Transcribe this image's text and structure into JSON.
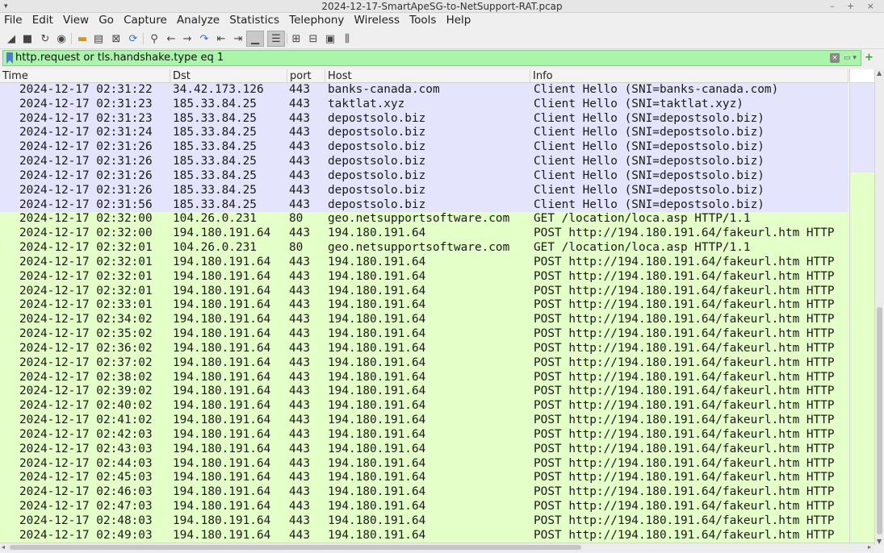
{
  "window": {
    "title": "2024-12-17-SmartApeSG-to-NetSupport-RAT.pcap",
    "controls": "– + ×"
  },
  "menu": [
    "File",
    "Edit",
    "View",
    "Go",
    "Capture",
    "Analyze",
    "Statistics",
    "Telephony",
    "Wireless",
    "Tools",
    "Help"
  ],
  "toolbar_icons": [
    "start-capture-icon",
    "stop-capture-icon",
    "restart-capture-icon",
    "capture-options-icon",
    "open-file-icon",
    "save-file-icon",
    "close-file-icon",
    "reload-file-icon",
    "find-packet-icon",
    "go-back-icon",
    "go-forward-icon",
    "go-to-packet-icon",
    "first-packet-icon",
    "last-packet-icon",
    "auto-scroll-icon",
    "colorize-icon",
    "zoom-in-icon",
    "zoom-out-icon",
    "normal-size-icon",
    "resize-columns-icon"
  ],
  "filter": {
    "value": "http.request or tls.handshake.type eq 1",
    "clear_glyph": "×",
    "recent_glyph": "▭ ▾",
    "apply_glyph": "+"
  },
  "columns": {
    "time": "Time",
    "dst": "Dst",
    "port": "port",
    "host": "Host",
    "info": "Info"
  },
  "colors": {
    "tls_row": "#e4e4fd",
    "http_row": "#e4ffc7",
    "filter_bg": "#aaf5aa"
  },
  "rows": [
    {
      "type": "tls",
      "time": "2024-12-17 02:31:22",
      "dst": "34.42.173.126",
      "port": "443",
      "host": "banks-canada.com",
      "info": "Client Hello (SNI=banks-canada.com)"
    },
    {
      "type": "tls",
      "time": "2024-12-17 02:31:23",
      "dst": "185.33.84.25",
      "port": "443",
      "host": "taktlat.xyz",
      "info": "Client Hello (SNI=taktlat.xyz)"
    },
    {
      "type": "tls",
      "time": "2024-12-17 02:31:23",
      "dst": "185.33.84.25",
      "port": "443",
      "host": "depostsolo.biz",
      "info": "Client Hello (SNI=depostsolo.biz)"
    },
    {
      "type": "tls",
      "time": "2024-12-17 02:31:24",
      "dst": "185.33.84.25",
      "port": "443",
      "host": "depostsolo.biz",
      "info": "Client Hello (SNI=depostsolo.biz)"
    },
    {
      "type": "tls",
      "time": "2024-12-17 02:31:26",
      "dst": "185.33.84.25",
      "port": "443",
      "host": "depostsolo.biz",
      "info": "Client Hello (SNI=depostsolo.biz)"
    },
    {
      "type": "tls",
      "time": "2024-12-17 02:31:26",
      "dst": "185.33.84.25",
      "port": "443",
      "host": "depostsolo.biz",
      "info": "Client Hello (SNI=depostsolo.biz)"
    },
    {
      "type": "tls",
      "time": "2024-12-17 02:31:26",
      "dst": "185.33.84.25",
      "port": "443",
      "host": "depostsolo.biz",
      "info": "Client Hello (SNI=depostsolo.biz)"
    },
    {
      "type": "tls",
      "time": "2024-12-17 02:31:26",
      "dst": "185.33.84.25",
      "port": "443",
      "host": "depostsolo.biz",
      "info": "Client Hello (SNI=depostsolo.biz)"
    },
    {
      "type": "tls",
      "time": "2024-12-17 02:31:56",
      "dst": "185.33.84.25",
      "port": "443",
      "host": "depostsolo.biz",
      "info": "Client Hello (SNI=depostsolo.biz)"
    },
    {
      "type": "http",
      "time": "2024-12-17 02:32:00",
      "dst": "104.26.0.231",
      "port": "80",
      "host": "geo.netsupportsoftware.com",
      "info": "GET /location/loca.asp HTTP/1.1"
    },
    {
      "type": "http",
      "time": "2024-12-17 02:32:00",
      "dst": "194.180.191.64",
      "port": "443",
      "host": "194.180.191.64",
      "info": "POST http://194.180.191.64/fakeurl.htm HTTP"
    },
    {
      "type": "http",
      "time": "2024-12-17 02:32:01",
      "dst": "104.26.0.231",
      "port": "80",
      "host": "geo.netsupportsoftware.com",
      "info": "GET /location/loca.asp HTTP/1.1"
    },
    {
      "type": "http",
      "time": "2024-12-17 02:32:01",
      "dst": "194.180.191.64",
      "port": "443",
      "host": "194.180.191.64",
      "info": "POST http://194.180.191.64/fakeurl.htm HTTP"
    },
    {
      "type": "http",
      "time": "2024-12-17 02:32:01",
      "dst": "194.180.191.64",
      "port": "443",
      "host": "194.180.191.64",
      "info": "POST http://194.180.191.64/fakeurl.htm HTTP"
    },
    {
      "type": "http",
      "time": "2024-12-17 02:32:01",
      "dst": "194.180.191.64",
      "port": "443",
      "host": "194.180.191.64",
      "info": "POST http://194.180.191.64/fakeurl.htm HTTP"
    },
    {
      "type": "http",
      "time": "2024-12-17 02:33:01",
      "dst": "194.180.191.64",
      "port": "443",
      "host": "194.180.191.64",
      "info": "POST http://194.180.191.64/fakeurl.htm HTTP"
    },
    {
      "type": "http",
      "time": "2024-12-17 02:34:02",
      "dst": "194.180.191.64",
      "port": "443",
      "host": "194.180.191.64",
      "info": "POST http://194.180.191.64/fakeurl.htm HTTP"
    },
    {
      "type": "http",
      "time": "2024-12-17 02:35:02",
      "dst": "194.180.191.64",
      "port": "443",
      "host": "194.180.191.64",
      "info": "POST http://194.180.191.64/fakeurl.htm HTTP"
    },
    {
      "type": "http",
      "time": "2024-12-17 02:36:02",
      "dst": "194.180.191.64",
      "port": "443",
      "host": "194.180.191.64",
      "info": "POST http://194.180.191.64/fakeurl.htm HTTP"
    },
    {
      "type": "http",
      "time": "2024-12-17 02:37:02",
      "dst": "194.180.191.64",
      "port": "443",
      "host": "194.180.191.64",
      "info": "POST http://194.180.191.64/fakeurl.htm HTTP"
    },
    {
      "type": "http",
      "time": "2024-12-17 02:38:02",
      "dst": "194.180.191.64",
      "port": "443",
      "host": "194.180.191.64",
      "info": "POST http://194.180.191.64/fakeurl.htm HTTP"
    },
    {
      "type": "http",
      "time": "2024-12-17 02:39:02",
      "dst": "194.180.191.64",
      "port": "443",
      "host": "194.180.191.64",
      "info": "POST http://194.180.191.64/fakeurl.htm HTTP"
    },
    {
      "type": "http",
      "time": "2024-12-17 02:40:02",
      "dst": "194.180.191.64",
      "port": "443",
      "host": "194.180.191.64",
      "info": "POST http://194.180.191.64/fakeurl.htm HTTP"
    },
    {
      "type": "http",
      "time": "2024-12-17 02:41:02",
      "dst": "194.180.191.64",
      "port": "443",
      "host": "194.180.191.64",
      "info": "POST http://194.180.191.64/fakeurl.htm HTTP"
    },
    {
      "type": "http",
      "time": "2024-12-17 02:42:03",
      "dst": "194.180.191.64",
      "port": "443",
      "host": "194.180.191.64",
      "info": "POST http://194.180.191.64/fakeurl.htm HTTP"
    },
    {
      "type": "http",
      "time": "2024-12-17 02:43:03",
      "dst": "194.180.191.64",
      "port": "443",
      "host": "194.180.191.64",
      "info": "POST http://194.180.191.64/fakeurl.htm HTTP"
    },
    {
      "type": "http",
      "time": "2024-12-17 02:44:03",
      "dst": "194.180.191.64",
      "port": "443",
      "host": "194.180.191.64",
      "info": "POST http://194.180.191.64/fakeurl.htm HTTP"
    },
    {
      "type": "http",
      "time": "2024-12-17 02:45:03",
      "dst": "194.180.191.64",
      "port": "443",
      "host": "194.180.191.64",
      "info": "POST http://194.180.191.64/fakeurl.htm HTTP"
    },
    {
      "type": "http",
      "time": "2024-12-17 02:46:03",
      "dst": "194.180.191.64",
      "port": "443",
      "host": "194.180.191.64",
      "info": "POST http://194.180.191.64/fakeurl.htm HTTP"
    },
    {
      "type": "http",
      "time": "2024-12-17 02:47:03",
      "dst": "194.180.191.64",
      "port": "443",
      "host": "194.180.191.64",
      "info": "POST http://194.180.191.64/fakeurl.htm HTTP"
    },
    {
      "type": "http",
      "time": "2024-12-17 02:48:03",
      "dst": "194.180.191.64",
      "port": "443",
      "host": "194.180.191.64",
      "info": "POST http://194.180.191.64/fakeurl.htm HTTP"
    },
    {
      "type": "http",
      "time": "2024-12-17 02:49:03",
      "dst": "194.180.191.64",
      "port": "443",
      "host": "194.180.191.64",
      "info": "POST http://194.180.191.64/fakeurl.htm HTTP"
    }
  ]
}
